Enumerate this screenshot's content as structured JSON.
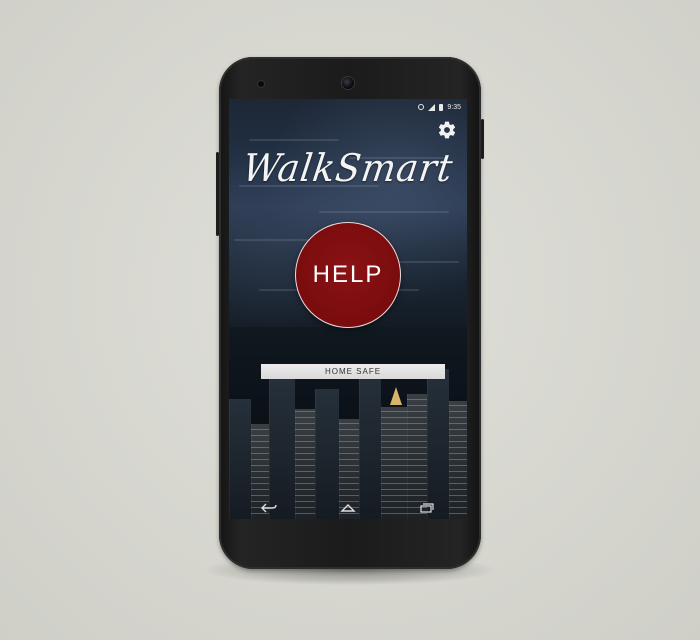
{
  "app": {
    "title": "WalkSmart"
  },
  "status_bar": {
    "time": "9:35",
    "icons": [
      "alarm-icon",
      "signal-icon",
      "battery-icon"
    ]
  },
  "toolbar": {
    "settings_icon": "gear-icon"
  },
  "main": {
    "help_label": "HELP",
    "home_safe_label": "HOME SAFE"
  },
  "nav_bar": {
    "buttons": [
      "back-icon",
      "home-icon",
      "recent-apps-icon"
    ]
  },
  "colors": {
    "help_button": "#7a0c0e",
    "home_safe_bg": "#e6e6e6",
    "title_text": "#f4f4f4"
  }
}
